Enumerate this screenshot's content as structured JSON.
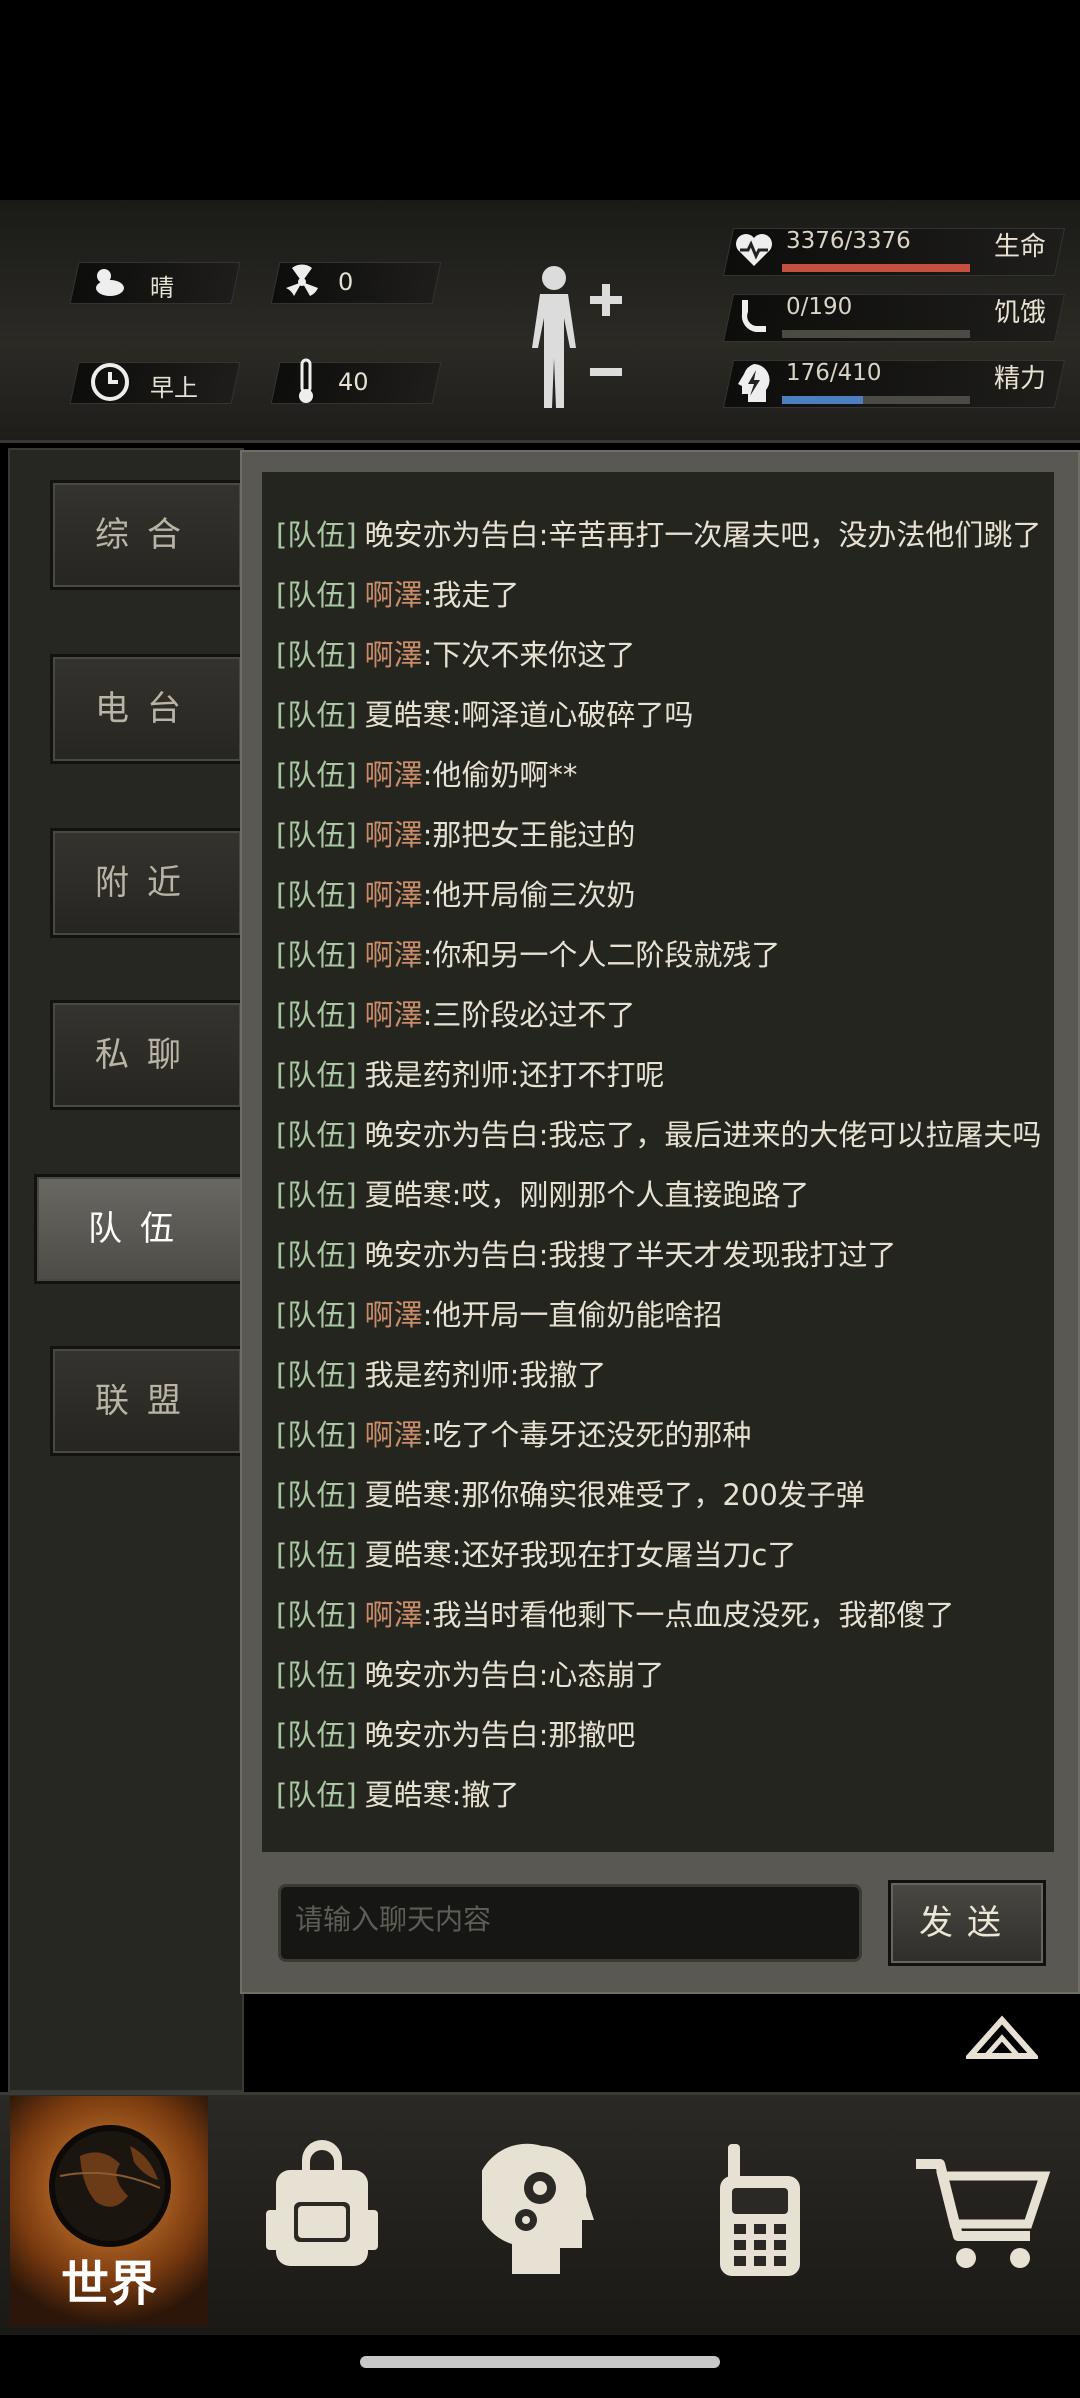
{
  "hud": {
    "weather": {
      "icon": "cloud-sun-icon",
      "label": "晴"
    },
    "radiation": {
      "icon": "radiation-icon",
      "value": "0"
    },
    "time": {
      "icon": "clock-icon",
      "label": "早上"
    },
    "temperature": {
      "icon": "thermometer-icon",
      "value": "40"
    },
    "body_icon": "body-status-icon",
    "stats": [
      {
        "key": "life",
        "label": "生命",
        "value": "3376/3376",
        "fill": 1.0,
        "color": "#c4513f",
        "icon": "heartbeat-icon"
      },
      {
        "key": "hunger",
        "label": "饥饿",
        "value": "0/190",
        "fill": 0.0,
        "color": "#7a766c",
        "icon": "stomach-icon"
      },
      {
        "key": "energy",
        "label": "精力",
        "value": "176/410",
        "fill": 0.43,
        "color": "#4d7fc0",
        "icon": "lightning-head-icon"
      }
    ]
  },
  "tabs": [
    {
      "label": "综合",
      "active": false
    },
    {
      "label": "电台",
      "active": false
    },
    {
      "label": "附近",
      "active": false
    },
    {
      "label": "私聊",
      "active": false
    },
    {
      "label": "队伍",
      "active": true
    },
    {
      "label": "联盟",
      "active": false
    }
  ],
  "chat": {
    "messages": [
      {
        "channel": "[队伍]",
        "name": "晚安亦为告白",
        "name_color": "white",
        "text": ":辛苦再打一次屠夫吧，没办法他们跳了"
      },
      {
        "channel": "[队伍]",
        "name": "啊澤",
        "name_color": "orange",
        "text": ":我走了"
      },
      {
        "channel": "[队伍]",
        "name": "啊澤",
        "name_color": "orange",
        "text": ":下次不来你这了"
      },
      {
        "channel": "[队伍]",
        "name": "夏皓寒",
        "name_color": "white",
        "text": ":啊泽道心破碎了吗"
      },
      {
        "channel": "[队伍]",
        "name": "啊澤",
        "name_color": "orange",
        "text": ":他偷奶啊**"
      },
      {
        "channel": "[队伍]",
        "name": "啊澤",
        "name_color": "orange",
        "text": ":那把女王能过的"
      },
      {
        "channel": "[队伍]",
        "name": "啊澤",
        "name_color": "orange",
        "text": ":他开局偷三次奶"
      },
      {
        "channel": "[队伍]",
        "name": "啊澤",
        "name_color": "orange",
        "text": ":你和另一个人二阶段就残了"
      },
      {
        "channel": "[队伍]",
        "name": "啊澤",
        "name_color": "orange",
        "text": ":三阶段必过不了"
      },
      {
        "channel": "[队伍]",
        "name": "我是药剂师",
        "name_color": "white",
        "text": ":还打不打呢"
      },
      {
        "channel": "[队伍]",
        "name": "晚安亦为告白",
        "name_color": "white",
        "text": ":我忘了，最后进来的大佬可以拉屠夫吗"
      },
      {
        "channel": "[队伍]",
        "name": "夏皓寒",
        "name_color": "white",
        "text": ":哎，刚刚那个人直接跑路了"
      },
      {
        "channel": "[队伍]",
        "name": "晚安亦为告白",
        "name_color": "white",
        "text": ":我搜了半天才发现我打过了"
      },
      {
        "channel": "[队伍]",
        "name": "啊澤",
        "name_color": "orange",
        "text": ":他开局一直偷奶能啥招"
      },
      {
        "channel": "[队伍]",
        "name": "我是药剂师",
        "name_color": "white",
        "text": ":我撤了"
      },
      {
        "channel": "[队伍]",
        "name": "啊澤",
        "name_color": "orange",
        "text": ":吃了个毒牙还没死的那种"
      },
      {
        "channel": "[队伍]",
        "name": "夏皓寒",
        "name_color": "white",
        "text": ":那你确实很难受了，200发子弹"
      },
      {
        "channel": "[队伍]",
        "name": "夏皓寒",
        "name_color": "white",
        "text": ":还好我现在打女屠当刀c了"
      },
      {
        "channel": "[队伍]",
        "name": "啊澤",
        "name_color": "orange",
        "text": ":我当时看他剩下一点血皮没死，我都傻了"
      },
      {
        "channel": "[队伍]",
        "name": "晚安亦为告白",
        "name_color": "white",
        "text": ":心态崩了"
      },
      {
        "channel": "[队伍]",
        "name": "晚安亦为告白",
        "name_color": "white",
        "text": ":那撤吧"
      },
      {
        "channel": "[队伍]",
        "name": "夏皓寒",
        "name_color": "white",
        "text": ":撤了"
      }
    ],
    "input_placeholder": "请输入聊天内容",
    "send_label": "发送"
  },
  "bottom_nav": {
    "world_label": "世界",
    "items": [
      {
        "icon": "globe-icon",
        "label": "世界"
      },
      {
        "icon": "backpack-icon"
      },
      {
        "icon": "head-gears-icon"
      },
      {
        "icon": "walkie-talkie-icon"
      },
      {
        "icon": "shopping-cart-icon"
      }
    ]
  }
}
